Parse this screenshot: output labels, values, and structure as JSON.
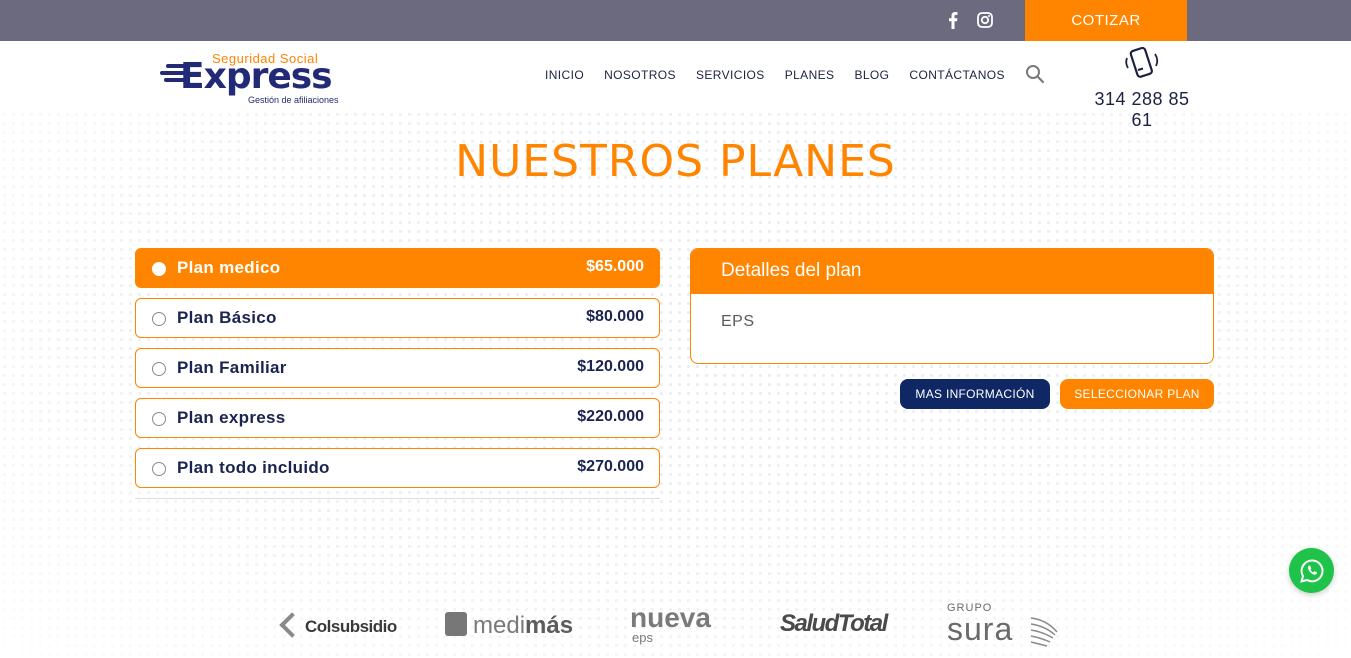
{
  "topbar": {
    "social_icons": [
      "facebook-icon",
      "instagram-icon"
    ],
    "cotizar_label": "COTIZAR"
  },
  "header": {
    "logo": {
      "top_text": "Seguridad Social",
      "main_text": "Express",
      "sub_text": "Gestión de afiliaciones"
    },
    "nav": [
      "INICIO",
      "NOSOTROS",
      "SERVICIOS",
      "PLANES",
      "BLOG",
      "CONTÁCTANOS"
    ],
    "search_icon": "search-icon",
    "phone_icon": "phone-icon",
    "phone_number": "314 288 85 61"
  },
  "section_title": "NUESTROS PLANES",
  "plans": [
    {
      "name": "Plan medico",
      "price": "$65.000",
      "selected": true
    },
    {
      "name": "Plan Básico",
      "price": "$80.000",
      "selected": false
    },
    {
      "name": "Plan Familiar",
      "price": "$120.000",
      "selected": false
    },
    {
      "name": "Plan express",
      "price": "$220.000",
      "selected": false
    },
    {
      "name": "Plan todo incluido",
      "price": "$270.000",
      "selected": false
    }
  ],
  "details": {
    "title": "Detalles del plan",
    "content": "EPS"
  },
  "buttons": {
    "more_info": "MAS INFORMACIÓN",
    "select_plan": "SELECCIONAR PLAN"
  },
  "partners": {
    "colsubsidio": "Colsubsidio",
    "medimas_light": "medi",
    "medimas_bold": "más",
    "nueva": "nueva",
    "nueva_sub": "eps",
    "saludtotal": "SaludTotal",
    "sura_top": "GRUPO",
    "sura_name": "sura"
  },
  "colors": {
    "orange": "#ff8400",
    "navy": "#0f2765",
    "topbar": "#6c6a7f",
    "whatsapp": "#1fc34a"
  },
  "whatsapp_icon": "whatsapp-icon"
}
